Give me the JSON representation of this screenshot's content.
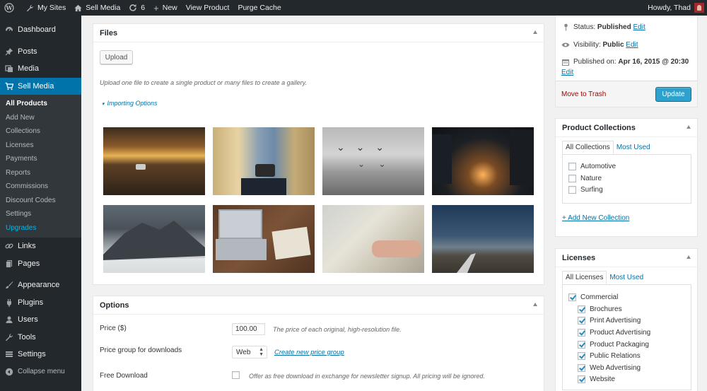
{
  "adminbar": {
    "wp_logo": "wordpress-icon",
    "my_sites": "My Sites",
    "site_name": "Sell Media",
    "updates_count": "6",
    "new_label": "New",
    "view_product": "View Product",
    "purge_cache": "Purge Cache",
    "howdy": "Howdy, Thad"
  },
  "sidebar": {
    "dashboard": "Dashboard",
    "posts": "Posts",
    "media": "Media",
    "sell_media": "Sell Media",
    "submenu": [
      "All Products",
      "Add New",
      "Collections",
      "Licenses",
      "Payments",
      "Reports",
      "Commissions",
      "Discount Codes",
      "Settings",
      "Upgrades"
    ],
    "links": "Links",
    "pages": "Pages",
    "appearance": "Appearance",
    "plugins": "Plugins",
    "users": "Users",
    "tools": "Tools",
    "settings": "Settings",
    "collapse": "Collapse menu"
  },
  "files": {
    "title": "Files",
    "upload_label": "Upload",
    "help": "Upload one file to create a single product or many files to create a gallery.",
    "importing_options": "Importing Options"
  },
  "options": {
    "title": "Options",
    "price_label": "Price ($)",
    "price_value": "100.00",
    "price_desc": "The price of each original, high-resolution file.",
    "price_group_label": "Price group for downloads",
    "price_group_value": "Web",
    "create_price_group": "Create new price group",
    "free_label": "Free Download",
    "free_desc": "Offer as free download in exchange for newsletter signup. All pricing will be ignored."
  },
  "publish": {
    "status_label": "Status:",
    "status_value": "Published",
    "visibility_label": "Visibility:",
    "visibility_value": "Public",
    "published_on_label": "Published on:",
    "published_on_value": "Apr 16, 2015 @ 20:30",
    "edit": "Edit",
    "trash": "Move to Trash",
    "update": "Update"
  },
  "collections": {
    "title": "Product Collections",
    "tab_all": "All Collections",
    "tab_most_used": "Most Used",
    "items": [
      "Automotive",
      "Nature",
      "Surfing"
    ],
    "add_new": "+ Add New Collection"
  },
  "licenses": {
    "title": "Licenses",
    "tab_all": "All Licenses",
    "tab_most_used": "Most Used",
    "parent": "Commercial",
    "children": [
      "Brochures",
      "Print Advertising",
      "Product Advertising",
      "Product Packaging",
      "Public Relations",
      "Web Advertising",
      "Website"
    ]
  },
  "colors": {
    "admin_dark": "#23282d",
    "accent": "#0073aa",
    "update_button": "#2ea2cc",
    "trash": "#a00"
  }
}
